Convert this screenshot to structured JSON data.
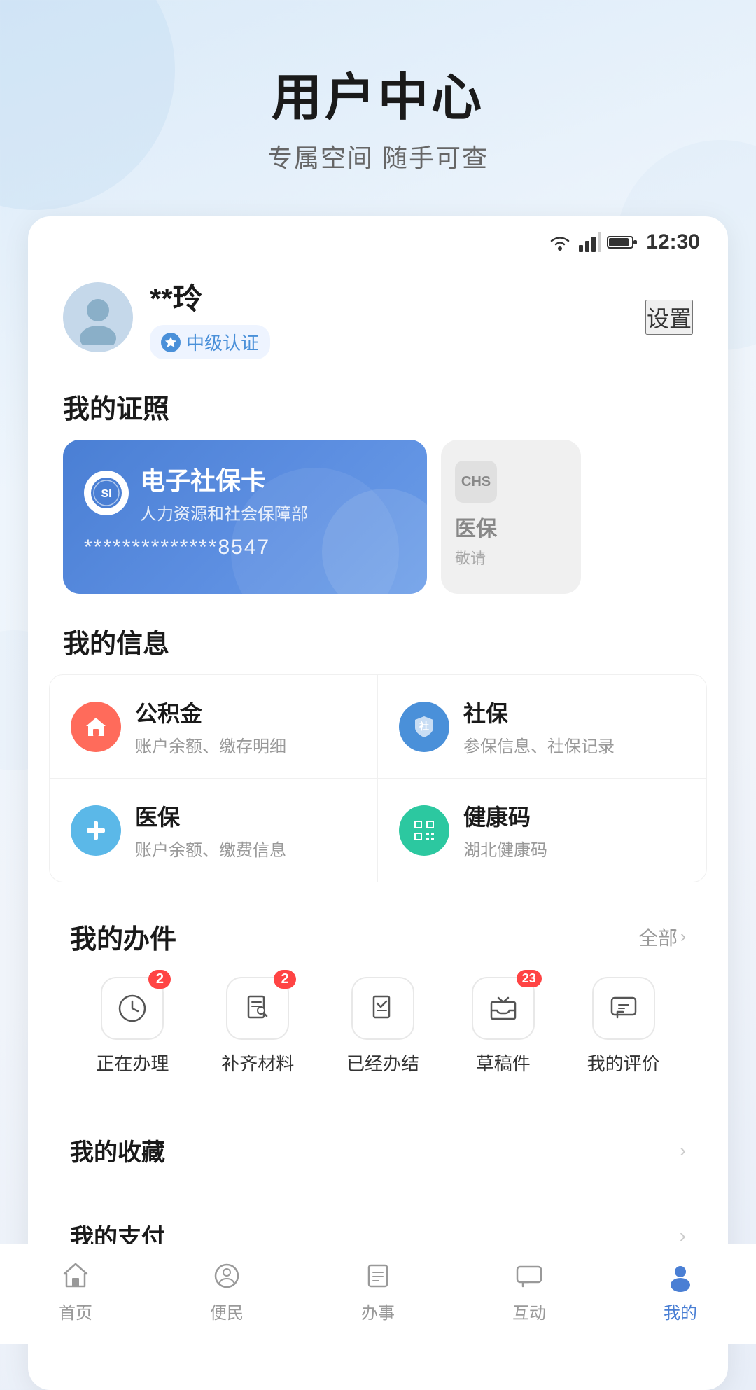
{
  "page": {
    "title": "用户中心",
    "subtitle": "专属空间 随手可查"
  },
  "status_bar": {
    "time": "12:30"
  },
  "user": {
    "name": "**玲",
    "cert_level": "中级认证",
    "settings_label": "设置"
  },
  "my_cards": {
    "section_title": "我的证照",
    "si_card": {
      "name": "电子社保卡",
      "org": "人力资源和社会保障部",
      "number": "**************8547",
      "logo_text": "SI"
    },
    "med_card": {
      "logo_text": "CHS",
      "name": "医保",
      "sub": "敬请"
    }
  },
  "my_info": {
    "section_title": "我的信息",
    "items": [
      {
        "name": "公积金",
        "desc": "账户余额、缴存明细",
        "icon": "house-icon",
        "icon_type": "red"
      },
      {
        "name": "社保",
        "desc": "参保信息、社保记录",
        "icon": "shield-icon",
        "icon_type": "blue"
      },
      {
        "name": "医保",
        "desc": "账户余额、缴费信息",
        "icon": "cross-icon",
        "icon_type": "light-blue"
      },
      {
        "name": "健康码",
        "desc": "湖北健康码",
        "icon": "qr-icon",
        "icon_type": "teal"
      }
    ]
  },
  "my_business": {
    "section_title": "我的办件",
    "all_label": "全部",
    "items": [
      {
        "label": "正在办理",
        "icon": "clock-icon",
        "badge": "2"
      },
      {
        "label": "补齐材料",
        "icon": "doc-edit-icon",
        "badge": "2"
      },
      {
        "label": "已经办结",
        "icon": "doc-check-icon",
        "badge": null
      },
      {
        "label": "草稿件",
        "icon": "inbox-icon",
        "badge": "23"
      },
      {
        "label": "我的评价",
        "icon": "comment-icon",
        "badge": null
      }
    ]
  },
  "my_collections": {
    "label": "我的收藏"
  },
  "my_payment": {
    "label": "我的支付"
  },
  "bottom_nav": {
    "items": [
      {
        "label": "首页",
        "icon": "home-nav-icon",
        "active": false
      },
      {
        "label": "便民",
        "icon": "service-nav-icon",
        "active": false
      },
      {
        "label": "办事",
        "icon": "task-nav-icon",
        "active": false
      },
      {
        "label": "互动",
        "icon": "chat-nav-icon",
        "active": false
      },
      {
        "label": "我的",
        "icon": "user-nav-icon",
        "active": true
      }
    ]
  }
}
